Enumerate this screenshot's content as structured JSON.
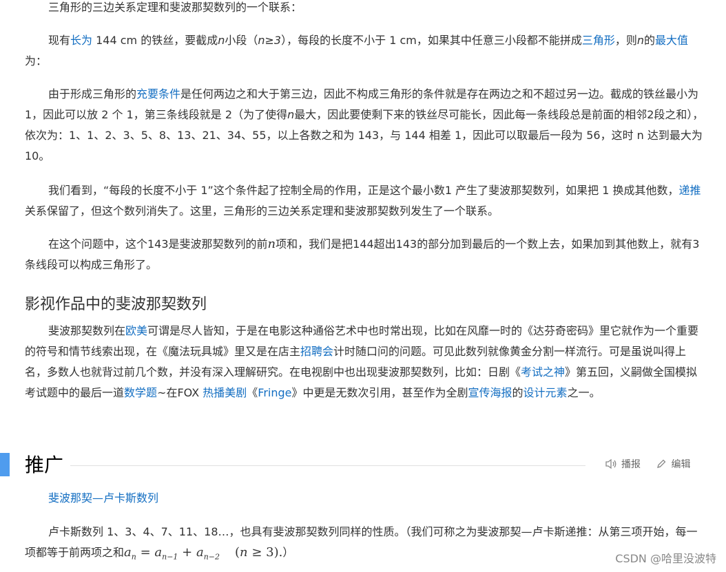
{
  "p0": "三角形的三边关系定理和斐波那契数列的一个联系：",
  "p1": {
    "t1": "现有",
    "l1": "长为",
    "t2": " 144 cm 的铁丝，要截成",
    "n1": "n",
    "t3": "小段（",
    "n2": "n≥3",
    "t4": "），每段的长度不小于 1 cm，如果其中任意三小段都不能拼成",
    "l2": "三角形",
    "t5": "，则",
    "n3": "n",
    "t6": "的",
    "l3": "最大值",
    "t7": "为："
  },
  "p2": {
    "t1": "由于形成三角形的",
    "l1": "充要条件",
    "t2": "是任何两边之和大于第三边，因此不构成三角形的条件就是存在两边之和不超过另一边。截成的铁丝最小为 1，因此可以放 2 个 1，第三条线段就是 2（为了使得",
    "n1": "n",
    "t3": "最大，因此要使剩下来的铁丝尽可能长，因此每一条线段总是前面的相邻2段之和），依次为：1、1、2、3、5、8、13、21、34、55，以上各数之和为 143，与 144 相差 1，因此可以取最后一段为 56，这时 n 达到最大为 10。"
  },
  "p3": {
    "t1": "我们看到，“每段的长度不小于 1”这个条件起了控制全局的作用，正是这个最小数1 产生了斐波那契数列，如果把 1 换成其他数，",
    "l1": "递推",
    "t2": "关系保留了，但这个数列消失了。这里，三角形的三边关系定理和斐波那契数列发生了一个联系。"
  },
  "p4": {
    "t1": "在这个问题中，这个143是斐波那契数列的前",
    "m1": "n",
    "t2": "项和，我们是把144超出143的部分加到最后的一个数上去，如果加到其他数上，就有3条线段可以构成三角形了。"
  },
  "h3": "影视作品中的斐波那契数列",
  "p5": {
    "t1": "斐波那契数列在",
    "l1": "欧美",
    "t2": "可谓是尽人皆知，于是在电影这种通俗艺术中也时常出现，比如在风靡一时的《达芬奇密码》里它就作为一个重要的符号和情节线索出现，在《魔法玩具城》里又是在店主",
    "l2": "招聘会",
    "t3": "计时随口问的问题。可见此数列就像黄金分割一样流行。可是虽说叫得上名，多数人也就背过前几个数，并没有深入理解研究。在电视剧中也出现斐波那契数列，比如：日剧《",
    "l3": "考试之神",
    "t4": "》第五回，义嗣做全国模拟考试题中的最后一道",
    "l4": "数学题",
    "t5": "~在FOX ",
    "l5": "热播美剧",
    "t6": "《",
    "l6": "Fringe",
    "t7": "》中更是无数次引用，甚至作为全剧",
    "l7": "宣传海报",
    "t8": "的",
    "l8": "设计元素",
    "t9": "之一。"
  },
  "h2": {
    "title": "推广",
    "tool_read": "播报",
    "tool_edit": "编辑",
    "icons": [
      "speaker-icon",
      "pencil-icon"
    ]
  },
  "sub_link": "斐波那契—卢卡斯数列",
  "p6": {
    "t1": "卢卡斯数列 1、3、4、7、11、18…，也具有斐波那契数列同样的性质。（我们可称之为斐波那契—卢卡斯递推：从第三项开始，每一项都等于前两项之和",
    "f_a1": "a",
    "f_s1": "n",
    "f_eq": " = ",
    "f_a2": "a",
    "f_s2": "n−1",
    "f_plus": " + ",
    "f_a3": "a",
    "f_s3": "n−2",
    "f_cond1": "(",
    "f_cond_n": "n",
    "f_cond2": " ≥ 3).",
    "t2": "）"
  },
  "watermark": "CSDN @哈里没波特",
  "colors": {
    "link": "#136ec2",
    "accent_bar": "#4f9cee",
    "text": "#333333"
  }
}
